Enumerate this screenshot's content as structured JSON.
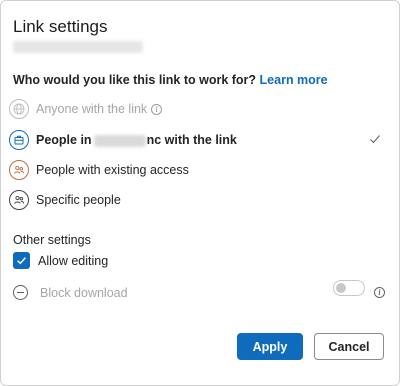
{
  "dialog": {
    "title": "Link settings",
    "question": "Who would you like this link to work for?",
    "learn_more": "Learn more"
  },
  "options": [
    {
      "label": "Anyone with the link",
      "icon": "globe-icon",
      "state": "disabled"
    },
    {
      "label_prefix": "People in",
      "label_suffix": "nc with the link",
      "icon": "building-icon",
      "state": "selected"
    },
    {
      "label": "People with existing access",
      "icon": "people-existing-icon",
      "state": "default"
    },
    {
      "label": "Specific people",
      "icon": "specific-people-icon",
      "state": "default"
    }
  ],
  "other_settings": {
    "heading": "Other settings",
    "allow_editing": {
      "label": "Allow editing",
      "checked": true
    },
    "block_download": {
      "label": "Block download",
      "enabled": false,
      "on": false
    }
  },
  "buttons": {
    "apply": "Apply",
    "cancel": "Cancel"
  },
  "colors": {
    "accent": "#0f6cbd",
    "disabled_text": "#a6a6a6",
    "existing_access_icon": "#c36b44"
  }
}
